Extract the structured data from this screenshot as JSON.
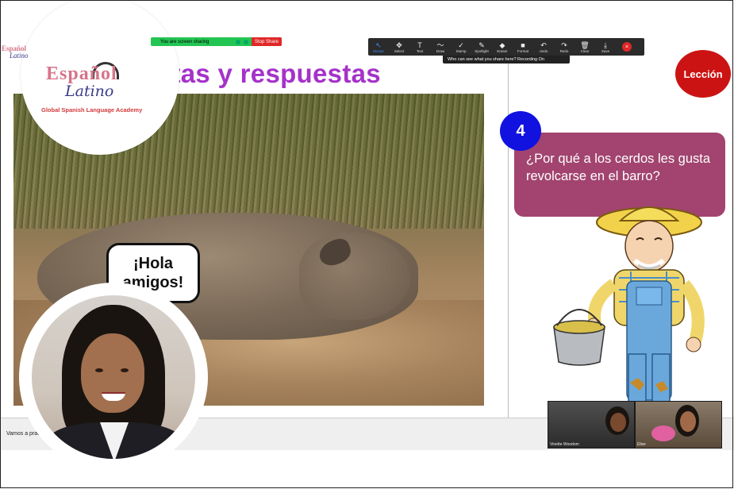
{
  "screen_share": {
    "status_text": "You are screen sharing",
    "stop_label": "Stop Share"
  },
  "annotation_toolbar": {
    "tools": [
      {
        "label": "Mouse",
        "icon": "mouse-pointer-icon",
        "glyph": "↖",
        "active": true
      },
      {
        "label": "Select",
        "icon": "select-move-icon",
        "glyph": "✥",
        "active": false
      },
      {
        "label": "Text",
        "icon": "text-icon",
        "glyph": "T",
        "active": false
      },
      {
        "label": "Draw",
        "icon": "draw-icon",
        "glyph": "〜",
        "active": false
      },
      {
        "label": "Stamp",
        "icon": "stamp-icon",
        "glyph": "✓",
        "active": false
      },
      {
        "label": "Spotlight",
        "icon": "spotlight-icon",
        "glyph": "✎",
        "active": false
      },
      {
        "label": "Eraser",
        "icon": "eraser-icon",
        "glyph": "◆",
        "active": false
      },
      {
        "label": "Format",
        "icon": "format-icon",
        "glyph": "■",
        "active": false
      },
      {
        "label": "Undo",
        "icon": "undo-icon",
        "glyph": "↶",
        "active": false
      },
      {
        "label": "Redo",
        "icon": "redo-icon",
        "glyph": "↷",
        "active": false
      },
      {
        "label": "Clear",
        "icon": "clear-trash-icon",
        "glyph": "🗑",
        "active": false
      },
      {
        "label": "Save",
        "icon": "save-icon",
        "glyph": "⤓",
        "active": false
      }
    ],
    "recording_notice": "Who can see what you share here? Recording On"
  },
  "slide": {
    "title": "ntas y respuestas",
    "logo_main": "Español",
    "logo_sub": "Latino",
    "logo_tagline": "Global Spanish Language Academy",
    "mini_logo_main": "Español",
    "mini_logo_sub": "Latino",
    "speech_bubble": "¡Hola amigos!",
    "lesson_button": "Lección",
    "question_number": "4",
    "question_text": "¿Por qué a los cerdos les gusta revolcarse en el barro?"
  },
  "meeting": {
    "chat_preview": "Vamos a prac",
    "participants": [
      {
        "name": "Vinette Woodom"
      },
      {
        "name": "Elise"
      }
    ]
  },
  "colors": {
    "title_purple": "#a532c9",
    "question_box": "#a2446f",
    "number_badge": "#1111e0",
    "lesson_red": "#cc1313",
    "share_green": "#23c552"
  }
}
